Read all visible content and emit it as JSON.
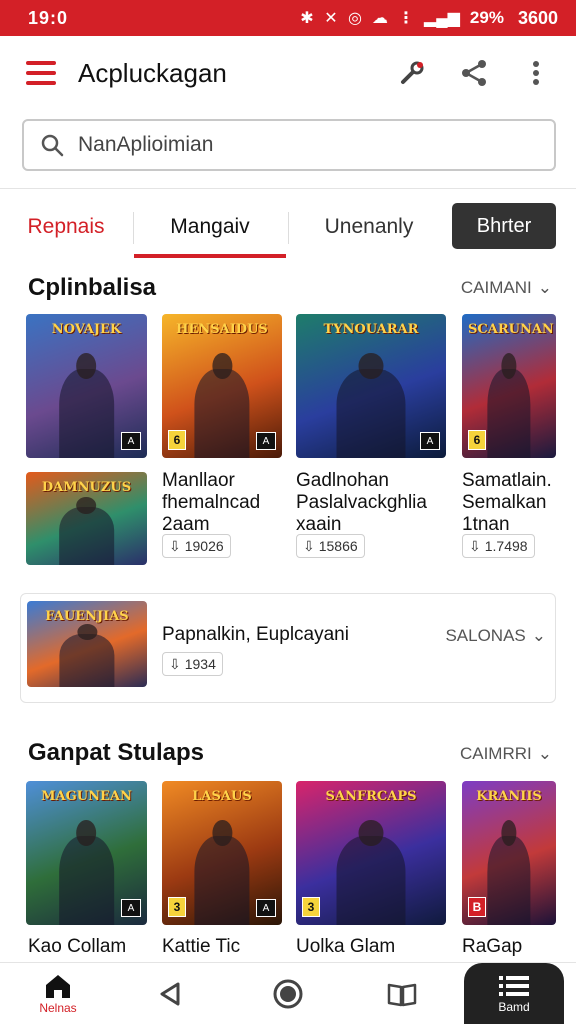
{
  "status_bar": {
    "time": "19:0",
    "battery": "29%",
    "clock": "3600",
    "bg_color": "#d32027"
  },
  "app_bar": {
    "title": "Acpluckagan",
    "icons": [
      "hamburger-menu-icon",
      "wrench-icon",
      "share-icon",
      "more-vert-icon"
    ]
  },
  "search": {
    "placeholder": "NanAplioimian"
  },
  "tabs": [
    {
      "label": "Repnais",
      "state": "accent"
    },
    {
      "label": "Mangaiv",
      "state": "selected"
    },
    {
      "label": "Unenanly",
      "state": "normal"
    },
    {
      "label": "Bhrter",
      "state": "button"
    }
  ],
  "section1": {
    "title": "Cplinbalisa",
    "see_all": "CAIMANI",
    "tiles": [
      {
        "art": "NOVAJEK",
        "colors": [
          "#3a73c2",
          "#6b4a8f",
          "#1d2c55"
        ]
      },
      {
        "art": "HENSAIDUS",
        "colors": [
          "#f6b52a",
          "#d0521b",
          "#4a1a08"
        ]
      },
      {
        "art": "TYNOUARAR",
        "colors": [
          "#1e7d6a",
          "#2a3e9e",
          "#0c1b3a"
        ]
      },
      {
        "art": "SCARUNAN",
        "colors": [
          "#1f6bc4",
          "#b12c38",
          "#1a1a3e"
        ]
      }
    ],
    "items": [
      {
        "art": "DAMNUZUS",
        "title": "Manllaor\nfhemalncad\n2aam",
        "size": "19026",
        "colors": [
          "#e45a1b",
          "#2f8f6b",
          "#2a2f6a"
        ]
      },
      {
        "title": "Gadlnohan\nPaslalvackghlia\nxaain",
        "size": "15866"
      },
      {
        "title": "Samatlain.\nSemalkan\n1tnan",
        "size": "1.7498"
      }
    ]
  },
  "card": {
    "art": "FAUENJIAS",
    "title": "Papnalkin, Euplcayani",
    "size": "1934",
    "action": "SALONAS",
    "colors": [
      "#3a7bd5",
      "#e36a2a",
      "#2c2c54"
    ]
  },
  "section2": {
    "title": "Ganpat Stulaps",
    "see_all": "CAIMRRI",
    "tiles": [
      {
        "art": "MAGUNEAN",
        "title": "Kao Collam",
        "colors": [
          "#4f8fd8",
          "#2f6e3a",
          "#1b2a3e"
        ]
      },
      {
        "art": "LASAUS",
        "title": "Kattie Tic",
        "colors": [
          "#f08a24",
          "#9c3a12",
          "#2b1607"
        ]
      },
      {
        "art": "SANFRCAPS",
        "title": "Uolka Glam",
        "colors": [
          "#d8246b",
          "#3b2f9e",
          "#101a3d"
        ]
      },
      {
        "art": "KRANIIS",
        "title": "RaGap",
        "colors": [
          "#7d3cc4",
          "#c23a3a",
          "#1c1238"
        ]
      }
    ]
  },
  "bottom_nav": [
    {
      "label": "Nelnas",
      "icon": "home-icon",
      "state": "active"
    },
    {
      "label": "",
      "icon": "back-triangle-icon",
      "state": "normal"
    },
    {
      "label": "",
      "icon": "home-circle-icon",
      "state": "normal"
    },
    {
      "label": "",
      "icon": "book-icon",
      "state": "normal"
    },
    {
      "label": "Bamd",
      "icon": "list-icon",
      "state": "dark"
    }
  ]
}
